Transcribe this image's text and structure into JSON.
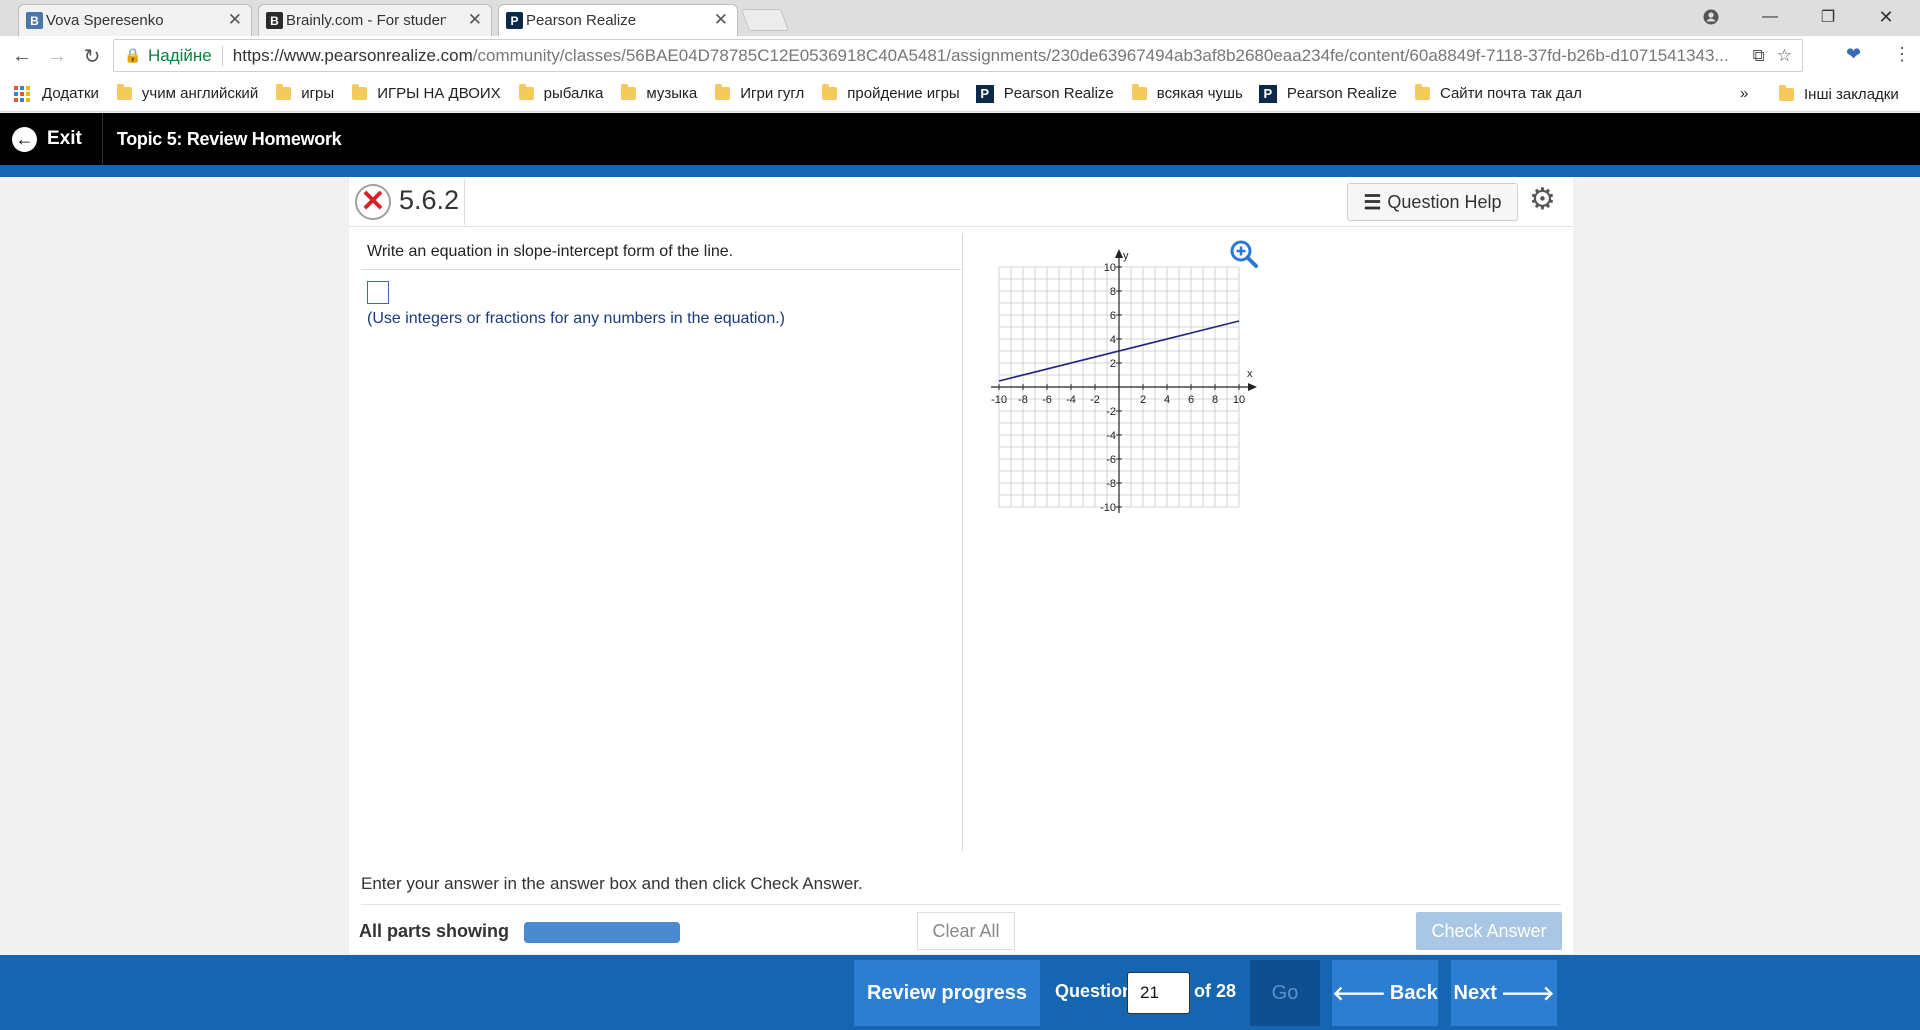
{
  "browser": {
    "tabs": [
      {
        "title": "Vova Speresenko",
        "favicon": "B",
        "favicon_color": "#4a76a8",
        "active": false
      },
      {
        "title": "Brainly.com - For students",
        "favicon": "B",
        "favicon_color": "#2b2b2b",
        "active": false
      },
      {
        "title": "Pearson Realize",
        "favicon": "P",
        "favicon_color": "#0b2a4a",
        "active": true
      }
    ],
    "secure_label": "Надійне",
    "url_host": "https://www.pearsonrealize.com",
    "url_path": "/community/classes/56BAE04D78785C12E0536918C40A5481/assignments/230de63967494ab3af8b2680eaa234fe/content/60a8849f-7118-37fd-b26b-d1071541343...",
    "bookmarks": [
      {
        "label": "Додатки",
        "icon": "apps-icon"
      },
      {
        "label": "учим английский",
        "icon": "folder-icon"
      },
      {
        "label": "игры",
        "icon": "folder-icon"
      },
      {
        "label": "ИГРЫ НА ДВОИХ",
        "icon": "folder-icon"
      },
      {
        "label": "рыбалка",
        "icon": "folder-icon"
      },
      {
        "label": "музыка",
        "icon": "folder-icon"
      },
      {
        "label": "Игри гугл",
        "icon": "folder-icon"
      },
      {
        "label": "пройдение игры",
        "icon": "folder-icon"
      },
      {
        "label": "Pearson Realize",
        "icon": "pearson-icon"
      },
      {
        "label": "всякая чушь",
        "icon": "folder-icon"
      },
      {
        "label": "Pearson Realize",
        "icon": "pearson-icon"
      },
      {
        "label": "Сайти почта так дал",
        "icon": "folder-icon"
      }
    ],
    "bookmarks_more": "»",
    "other_bookmarks": "Інші закладки"
  },
  "app": {
    "exit_label": "Exit",
    "topic_title": "Topic 5: Review Homework"
  },
  "question": {
    "number": "5.6.2",
    "help_label": "Question Help",
    "prompt": "Write an equation in slope-intercept form of the line.",
    "hint": "(Use integers or fractions for any numbers in the equation.)",
    "enter_message": "Enter your answer in the answer box and then click Check Answer.",
    "parts_label": "All parts showing",
    "progress_fraction": 1.0,
    "clear_all_label": "Clear All",
    "check_answer_label": "Check Answer"
  },
  "graph": {
    "x_label": "x",
    "y_label": "y",
    "x_ticks": [
      "-10",
      "-8",
      "-6",
      "-4",
      "-2",
      "2",
      "4",
      "6",
      "8",
      "10"
    ],
    "y_ticks": [
      "10",
      "8",
      "6",
      "4",
      "2",
      "-2",
      "-4",
      "-6",
      "-8",
      "-10"
    ],
    "xlim": [
      -10,
      10
    ],
    "ylim": [
      -10,
      10
    ],
    "line": {
      "x1": -10,
      "y1": 0.5,
      "x2": 10,
      "y2": 5.5,
      "color": "#1f2a7a"
    },
    "grid": true
  },
  "footer": {
    "review_progress_label": "Review progress",
    "question_label": "Question",
    "current_question": "21",
    "of_label": "of 28",
    "go_label": "Go",
    "back_label": "Back",
    "next_label": "Next"
  },
  "colors": {
    "brand_blue": "#1565b0",
    "button_blue": "#2b7ed1",
    "error_red": "#d6232a"
  }
}
